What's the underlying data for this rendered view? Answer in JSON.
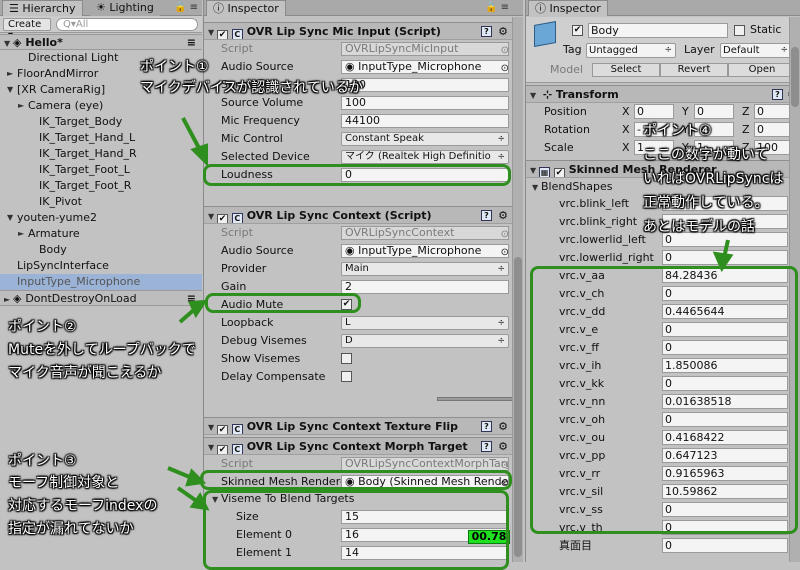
{
  "hierarchy": {
    "tabs": [
      "Hierarchy",
      "Lighting"
    ],
    "create_label": "Create ▾",
    "search_placeholder": "Q▾All",
    "scene": "Hello*",
    "items": [
      {
        "label": "Directional Light",
        "indent": 2,
        "arrow": ""
      },
      {
        "label": "FloorAndMirror",
        "indent": 1,
        "arrow": "►"
      },
      {
        "label": "[XR CameraRig]",
        "indent": 1,
        "arrow": "▼"
      },
      {
        "label": "Camera (eye)",
        "indent": 2,
        "arrow": "►"
      },
      {
        "label": "IK_Target_Body",
        "indent": 3,
        "arrow": ""
      },
      {
        "label": "IK_Target_Hand_L",
        "indent": 3,
        "arrow": ""
      },
      {
        "label": "IK_Target_Hand_R",
        "indent": 3,
        "arrow": ""
      },
      {
        "label": "IK_Target_Foot_L",
        "indent": 3,
        "arrow": ""
      },
      {
        "label": "IK_Target_Foot_R",
        "indent": 3,
        "arrow": ""
      },
      {
        "label": "IK_Pivot",
        "indent": 3,
        "arrow": ""
      },
      {
        "label": "youten-yume2",
        "indent": 1,
        "arrow": "▼"
      },
      {
        "label": "Armature",
        "indent": 2,
        "arrow": "►"
      },
      {
        "label": "Body",
        "indent": 3,
        "arrow": ""
      },
      {
        "label": "LipSyncInterface",
        "indent": 1,
        "arrow": ""
      },
      {
        "label": "InputType_Microphone",
        "indent": 1,
        "arrow": "",
        "selected": true
      }
    ],
    "scene2": "DontDestroyOnLoad"
  },
  "inspector": {
    "tab": "Inspector",
    "mic_component": {
      "title": "OVR Lip Sync Mic Input (Script)",
      "rows": [
        {
          "label": "Script",
          "value": "OVRLipSyncMicInput",
          "kind": "ro"
        },
        {
          "label": "Audio Source",
          "value": "InputType_Microphone",
          "kind": "obj"
        },
        {
          "label": "Sensitivity",
          "value": "100",
          "kind": "val"
        },
        {
          "label": "Source Volume",
          "value": "100",
          "kind": "val"
        },
        {
          "label": "Mic Frequency",
          "value": "44100",
          "kind": "val"
        },
        {
          "label": "Mic Control",
          "value": "Constant Speak",
          "kind": "pop"
        },
        {
          "label": "Selected Device",
          "value": "マイク (Realtek High Definitio",
          "kind": "pop"
        },
        {
          "label": "Loudness",
          "value": "0",
          "kind": "val"
        }
      ]
    },
    "context_component": {
      "title": "OVR Lip Sync Context (Script)",
      "rows": [
        {
          "label": "Script",
          "value": "OVRLipSyncContext",
          "kind": "ro"
        },
        {
          "label": "Audio Source",
          "value": "InputType_Microphone",
          "kind": "obj"
        },
        {
          "label": "Provider",
          "value": "Main",
          "kind": "pop"
        },
        {
          "label": "Gain",
          "value": "2",
          "kind": "val"
        },
        {
          "label": "Audio Mute",
          "value": "✔",
          "kind": "chk"
        },
        {
          "label": "Loopback",
          "value": "L",
          "kind": "pop"
        },
        {
          "label": "Debug Visemes",
          "value": "D",
          "kind": "pop"
        },
        {
          "label": "Show Visemes",
          "value": "",
          "kind": "chk"
        },
        {
          "label": "Delay Compensate",
          "value": "",
          "kind": "chk"
        }
      ],
      "viseme_value": "00.78"
    },
    "texture_component": {
      "title": "OVR Lip Sync Context Texture Flip"
    },
    "morph_component": {
      "title": "OVR Lip Sync Context Morph Target",
      "rows": [
        {
          "label": "Script",
          "value": "OVRLipSyncContextMorphTarget",
          "kind": "ro"
        },
        {
          "label": "Skinned Mesh Renderer",
          "value": "Body (Skinned Mesh Renderer)",
          "kind": "obj"
        }
      ],
      "viseme_header": "Viseme To Blend Targets",
      "sub_rows": [
        {
          "label": "Size",
          "value": "15"
        },
        {
          "label": "Element 0",
          "value": "16"
        },
        {
          "label": "Element 1",
          "value": "14"
        }
      ]
    }
  },
  "inspector2": {
    "tab": "Inspector",
    "object_name": "Body",
    "static_label": "Static",
    "tag_label": "Tag",
    "tag_value": "Untagged",
    "layer_label": "Layer",
    "layer_value": "Default",
    "model_label": "Model",
    "model_buttons": [
      "Select",
      "Revert",
      "Open"
    ],
    "transform_title": "Transform",
    "position_label": "Position",
    "rotation_label": "Rotation",
    "scale_label": "Scale",
    "position": [
      "0",
      "0",
      "0"
    ],
    "rotation": [
      "-",
      "",
      "0"
    ],
    "scale": [
      "1",
      "1",
      "100"
    ],
    "smr_title": "Skinned Mesh Renderer",
    "blendshapes_label": "BlendShapes",
    "blendshapes": [
      {
        "name": "vrc.blink_left",
        "value": ""
      },
      {
        "name": "vrc.blink_right",
        "value": ""
      },
      {
        "name": "vrc.lowerlid_left",
        "value": "0"
      },
      {
        "name": "vrc.lowerlid_right",
        "value": "0"
      },
      {
        "name": "vrc.v_aa",
        "value": "84.28436"
      },
      {
        "name": "vrc.v_ch",
        "value": "0"
      },
      {
        "name": "vrc.v_dd",
        "value": "0.4465644"
      },
      {
        "name": "vrc.v_e",
        "value": "0"
      },
      {
        "name": "vrc.v_ff",
        "value": "0"
      },
      {
        "name": "vrc.v_ih",
        "value": "1.850086"
      },
      {
        "name": "vrc.v_kk",
        "value": "0"
      },
      {
        "name": "vrc.v_nn",
        "value": "0.01638518"
      },
      {
        "name": "vrc.v_oh",
        "value": "0"
      },
      {
        "name": "vrc.v_ou",
        "value": "0.4168422"
      },
      {
        "name": "vrc.v_pp",
        "value": "0.647123"
      },
      {
        "name": "vrc.v_rr",
        "value": "0.9165963"
      },
      {
        "name": "vrc.v_sil",
        "value": "10.59862"
      },
      {
        "name": "vrc.v_ss",
        "value": "0"
      },
      {
        "name": "vrc.v_th",
        "value": "0"
      },
      {
        "name": "真面目",
        "value": "0"
      }
    ]
  },
  "annotations": {
    "a1_title": "ポイント①",
    "a1_line1": "マイクデバイスが認識されているか",
    "a2_title": "ポイント②",
    "a2_line1": "Muteを外してループバックで",
    "a2_line2": "マイク音声が聞こえるか",
    "a3_title": "ポイント③",
    "a3_line1": "モーフ制御対象と",
    "a3_line2": "対応するモーフindexの",
    "a3_line3": "指定が漏れてないか",
    "a4_title": "ポイント④",
    "a4_line1": "ここの数字が動いて",
    "a4_line2": "いればOVRLipSyncは",
    "a4_line3": "正常動作している。",
    "a4_line4": "あとはモデルの話"
  },
  "colors": {
    "highlight_box": "#2f8f1e",
    "selection": "#9bb3d6",
    "viseme_green": "#1ee01e"
  }
}
